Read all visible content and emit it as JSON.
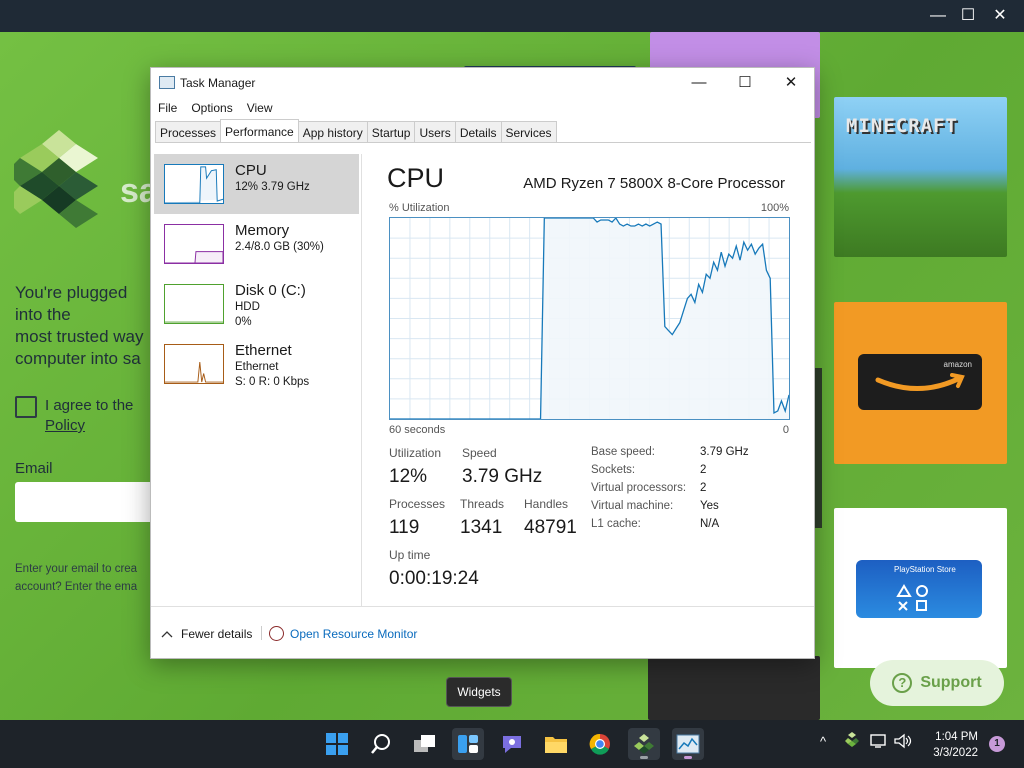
{
  "outer_window": {
    "minimize": "—",
    "maximize": "☐",
    "close": "✕"
  },
  "background_app": {
    "logo_text": "sa",
    "pitch": "You're plugged into the\nmost trusted way\ncomputer into sa",
    "agree_text": "I agree to the",
    "policy_link": "Policy",
    "email_label": "Email",
    "help_text": "Enter your email to crea\naccount? Enter the ema",
    "minecraft_title": "MINECRAFT",
    "amazon_card_text": "amazon",
    "ps_card_text": "PlayStation Store",
    "support_label": "Support",
    "support_icon": "question-circle"
  },
  "task_manager": {
    "title": "Task Manager",
    "controls": {
      "minimize": "—",
      "maximize": "☐",
      "close": "✕"
    },
    "menu": [
      "File",
      "Options",
      "View"
    ],
    "tabs": [
      "Processes",
      "Performance",
      "App history",
      "Startup",
      "Users",
      "Details",
      "Services"
    ],
    "active_tab": "Performance",
    "resources": [
      {
        "name": "CPU",
        "line1": "12%  3.79 GHz",
        "line2": "",
        "color": "#1779ba"
      },
      {
        "name": "Memory",
        "line1": "2.4/8.0 GB (30%)",
        "line2": "",
        "color": "#8b2fa3"
      },
      {
        "name": "Disk 0 (C:)",
        "line1": "HDD",
        "line2": "0%",
        "color": "#4fa12e"
      },
      {
        "name": "Ethernet",
        "line1": "Ethernet",
        "line2": "S: 0  R: 0 Kbps",
        "color": "#a75c17"
      }
    ],
    "cpu": {
      "title": "CPU",
      "model": "AMD Ryzen 7 5800X 8-Core Processor",
      "util_label": "% Utilization",
      "util_max": "100%",
      "x_left": "60 seconds",
      "x_right": "0",
      "graph_color": "#1779ba",
      "graph_fill": "#f1f6fb",
      "graph_data": [
        0,
        0,
        0,
        0,
        0,
        0,
        0,
        0,
        0,
        0,
        0,
        0,
        0,
        0,
        0,
        0,
        0,
        0,
        0,
        0,
        0,
        0,
        0,
        0,
        0,
        0,
        0,
        0,
        0,
        0,
        0,
        0,
        0,
        0,
        0,
        0,
        0,
        0,
        0,
        0,
        0,
        100,
        100,
        100,
        100,
        100,
        100,
        100,
        100,
        100,
        100,
        100,
        100,
        100,
        100,
        98,
        99,
        99,
        99,
        98,
        100,
        97,
        96,
        97,
        96,
        96,
        97,
        96,
        97,
        96,
        97,
        98,
        97,
        46,
        44,
        42,
        45,
        48,
        54,
        60,
        62,
        58,
        67,
        63,
        72,
        70,
        78,
        74,
        83,
        76,
        82,
        80,
        86,
        79,
        88,
        84,
        87,
        82,
        85,
        87,
        74,
        70,
        3,
        4,
        9,
        4,
        12
      ],
      "stats": [
        {
          "label": "Utilization",
          "value": "12%"
        },
        {
          "label": "Speed",
          "value": "3.79 GHz"
        },
        {
          "label": "Processes",
          "value": "119"
        },
        {
          "label": "Threads",
          "value": "1341"
        },
        {
          "label": "Handles",
          "value": "48791"
        },
        {
          "label": "Up time",
          "value": "0:00:19:24"
        }
      ],
      "specs": [
        {
          "label": "Base speed:",
          "value": "3.79 GHz"
        },
        {
          "label": "Sockets:",
          "value": "2"
        },
        {
          "label": "Virtual processors:",
          "value": "2"
        },
        {
          "label": "Virtual machine:",
          "value": "Yes"
        },
        {
          "label": "L1 cache:",
          "value": "N/A"
        }
      ]
    },
    "footer": {
      "fewer_details": "Fewer details",
      "open_resource_monitor": "Open Resource Monitor"
    }
  },
  "tooltip": "Widgets",
  "taskbar": {
    "icons": [
      "windows-start-icon",
      "search-icon",
      "task-view-icon",
      "widgets-icon",
      "teams-chat-icon",
      "file-explorer-icon",
      "chrome-icon",
      "app-logo-icon",
      "task-manager-icon"
    ],
    "clock_time": "1:04 PM",
    "clock_date": "3/3/2022",
    "notification_count": "1",
    "tray_chevron": "^"
  }
}
